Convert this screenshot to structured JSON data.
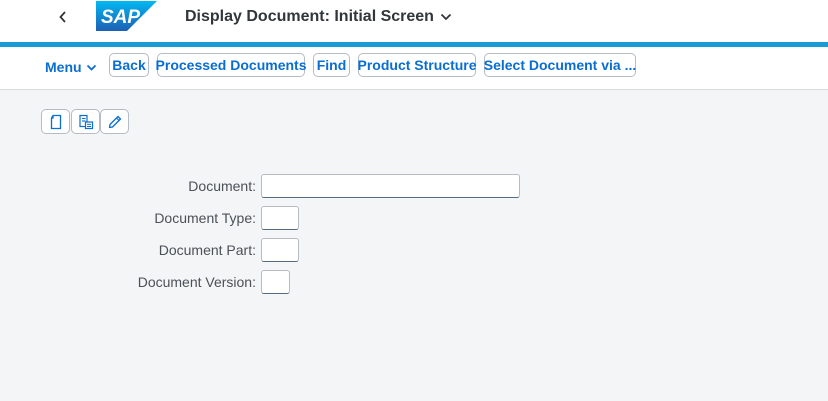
{
  "shell": {
    "logo_text": "SAP",
    "title": "Display Document: Initial Screen",
    "back_icon": "chevron-left-icon",
    "title_dropdown_icon": "chevron-down-icon",
    "brand_color": "#0a6ed1",
    "accent_color": "#1a9ad6"
  },
  "toolbar": {
    "menu_label": "Menu",
    "back_label": "Back",
    "processed_documents_label": "Processed Documents",
    "find_label": "Find",
    "product_structure_label": "Product Structure",
    "select_document_via_label": "Select Document via ..."
  },
  "actions": {
    "icons": [
      "create-document-icon",
      "document-list-icon",
      "edit-pencil-icon"
    ]
  },
  "form": {
    "document_label": "Document:",
    "document_value": "",
    "document_type_label": "Document Type:",
    "document_type_value": "",
    "document_part_label": "Document Part:",
    "document_part_value": "",
    "document_version_label": "Document Version:",
    "document_version_value": ""
  }
}
